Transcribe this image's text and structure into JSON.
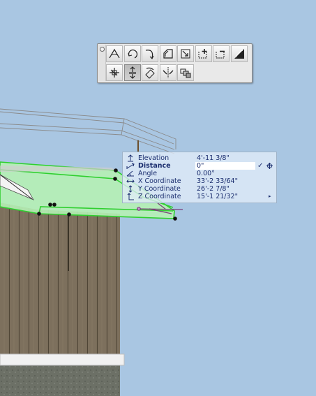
{
  "palette": {
    "tools_row1": [
      {
        "name": "arc-polygon-icon"
      },
      {
        "name": "rotate-icon"
      },
      {
        "name": "curved-arrow-icon"
      },
      {
        "name": "offset-shape-icon"
      },
      {
        "name": "stretch-icon"
      },
      {
        "name": "add-node-icon"
      },
      {
        "name": "subtract-node-icon"
      },
      {
        "name": "fillet-icon"
      }
    ],
    "tools_row2": [
      {
        "name": "drag-icon"
      },
      {
        "name": "elevate-icon",
        "active": true
      },
      {
        "name": "rotate-copy-icon"
      },
      {
        "name": "mirror-icon"
      },
      {
        "name": "multiply-icon"
      }
    ]
  },
  "tracker": {
    "rows": [
      {
        "label": "Elevation",
        "value": "4'-11 3/8\"",
        "icon": "elevation-icon"
      },
      {
        "label": "Distance",
        "value": "0\"",
        "icon": "distance-icon",
        "editable": true
      },
      {
        "label": "Angle",
        "value": "0.00°",
        "icon": "angle-icon"
      },
      {
        "label": "X Coordinate",
        "value": "33'-2 33/64\"",
        "icon": "x-coordinate-icon"
      },
      {
        "label": "Y Coordinate",
        "value": "26'-2 7/8\"",
        "icon": "y-coordinate-icon"
      },
      {
        "label": "Z Coordinate",
        "value": "15'-1 21/32\"",
        "icon": "z-coordinate-icon"
      }
    ],
    "accept_symbol": "✓",
    "more_symbol": "▸"
  },
  "colors": {
    "sky": "#a9c6e2",
    "selection_green": "#33cc33",
    "selection_fill": "#b5f0b5",
    "siding": "#7a6e5c",
    "tracker_text": "#1a2d6e"
  }
}
